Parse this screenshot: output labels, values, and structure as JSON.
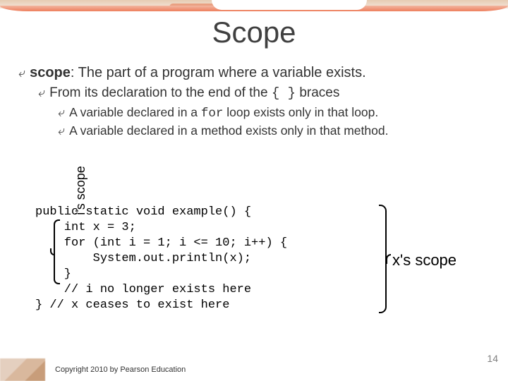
{
  "title": "Scope",
  "bullets": {
    "b1_term": "scope",
    "b1_rest": ": The part of a program where a variable exists.",
    "b2_a": "From its declaration to the end of the ",
    "b2_code": "{ }",
    "b2_b": " braces",
    "b3_a": "A variable declared in a ",
    "b3_code": "for",
    "b3_b": " loop exists only in that loop.",
    "b4": "A variable declared in a method exists only in that method."
  },
  "code": "public static void example() {\n    int x = 3;\n    for (int i = 1; i <= 10; i++) {\n        System.out.println(x);\n    }\n    // i no longer exists here\n} // x ceases to exist here",
  "labels": {
    "i_scope": "i's scope",
    "x_scope": "x's scope"
  },
  "pagenum": "14",
  "copyright": "Copyright 2010 by Pearson Education",
  "glyphs": {
    "bullet": "⤶"
  }
}
